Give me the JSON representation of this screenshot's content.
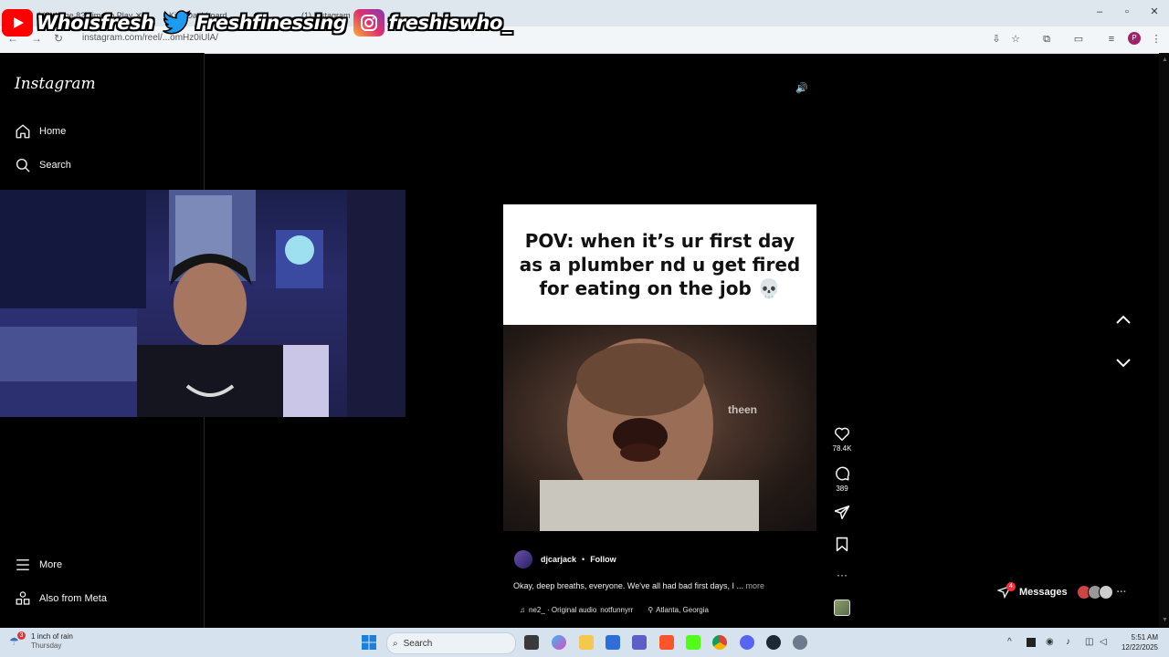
{
  "browser": {
    "tabs": [
      {
        "title": "(VS) | The 8? Time to Play"
      },
      {
        "title": "Kick Dashboard"
      },
      {
        "title": "(1) Instagram"
      }
    ],
    "url": "instagram.com/reel/...omHz0iUlA/",
    "profile_initial": "P"
  },
  "stream_banner": [
    {
      "platform": "youtube-icon",
      "handle": "Whoisfresh"
    },
    {
      "platform": "twitter-icon",
      "handle": "Freshfinessing"
    },
    {
      "platform": "instagram-icon",
      "handle": "freshiswho_"
    }
  ],
  "sidebar": {
    "logo": "Instagram",
    "items": [
      {
        "label": "Home",
        "icon": "home-icon"
      },
      {
        "label": "Search",
        "icon": "search-icon"
      },
      {
        "label": "More",
        "icon": "menu-icon"
      },
      {
        "label": "Also from Meta",
        "icon": "meta-apps-icon"
      }
    ]
  },
  "reel": {
    "caption_card": "POV: when it’s ur first day as a plumber nd u get fired for eating on the job 💀",
    "video_overlay_text": "theen",
    "author": "djcarjack",
    "follow_label": "Follow",
    "description": "Okay, deep breaths, everyone. We've all had bad first days, I ...",
    "more_label": "more",
    "audio": "ne2_ · Original audio",
    "tag": "notfunnyrr",
    "location": "Atlanta, Georgia"
  },
  "actions": {
    "likes": "78.4K",
    "comments": "389"
  },
  "messages": {
    "label": "Messages",
    "badge": "4"
  },
  "taskbar": {
    "weather_title": "1 inch of rain",
    "weather_day": "Thursday",
    "weather_badge": "3",
    "search_placeholder": "Search",
    "time": "5:51 AM",
    "date": "12/22/2025"
  }
}
